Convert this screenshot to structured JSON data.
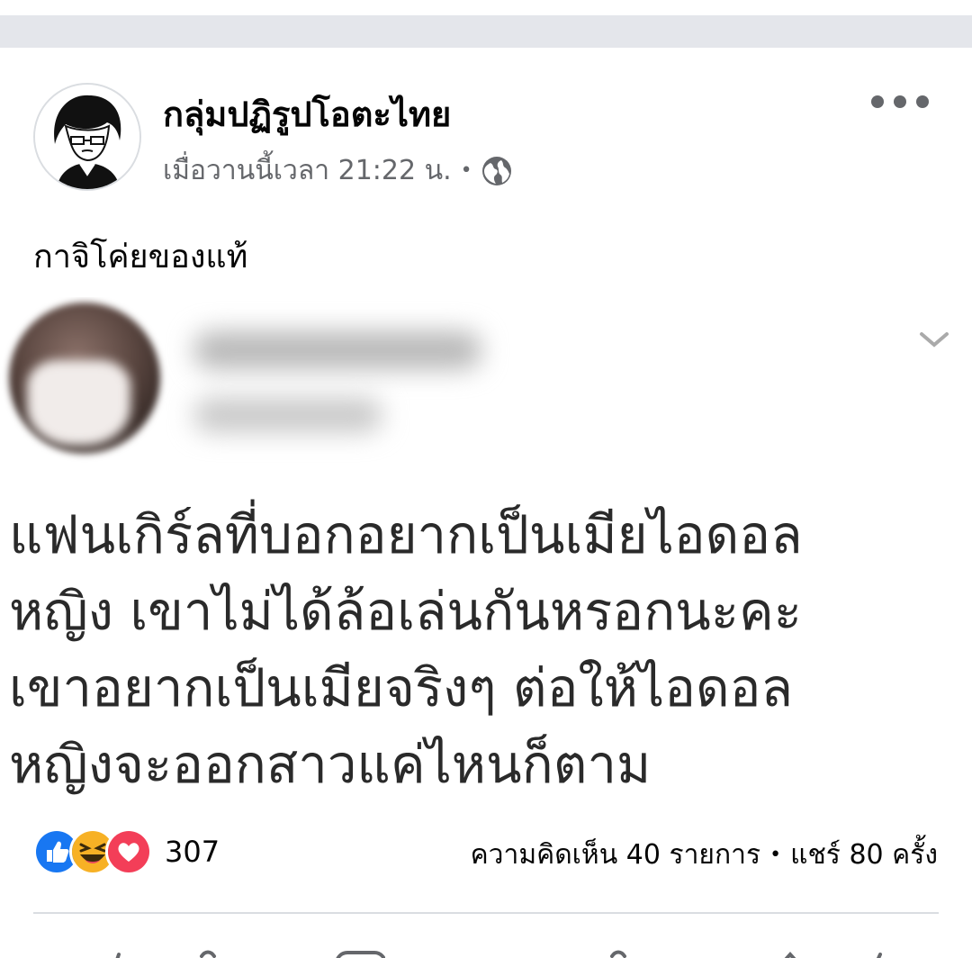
{
  "post": {
    "group_name": "กลุ่มปฏิรูปโอตะไทย",
    "timestamp": "เมื่อวานนี้เวลา 21:22 น.",
    "meta_separator": "•",
    "privacy_icon": "globe-icon",
    "menu_icon": "more-icon",
    "caption": "กาจิโค่ยของแท้"
  },
  "shared_image": {
    "text_lines": [
      "แฟนเกิร์ลที่บอกอยากเป็นเมียไอดอล",
      "หญิง เขาไม่ได้ล้อเล่นกันหรอกนะคะ",
      "เขาอยากเป็นเมียจริงๆ ต่อให้ไอดอล",
      "หญิงจะออกสาวแค่ไหนก็ตาม"
    ],
    "chevron_icon": "chevron-down-icon"
  },
  "footer": {
    "reaction_icons": [
      "like-icon",
      "haha-icon",
      "love-icon"
    ],
    "reaction_count": "307",
    "comments": "ความคิดเห็น 40 รายการ",
    "separator": "•",
    "shares": "แชร์ 80 ครั้ง"
  },
  "colors": {
    "top_band": "#e4e6eb",
    "secondary_text": "#65676b",
    "like_blue": "#1877f2",
    "love_red": "#f33e58",
    "haha_yellow": "#f7b125"
  }
}
